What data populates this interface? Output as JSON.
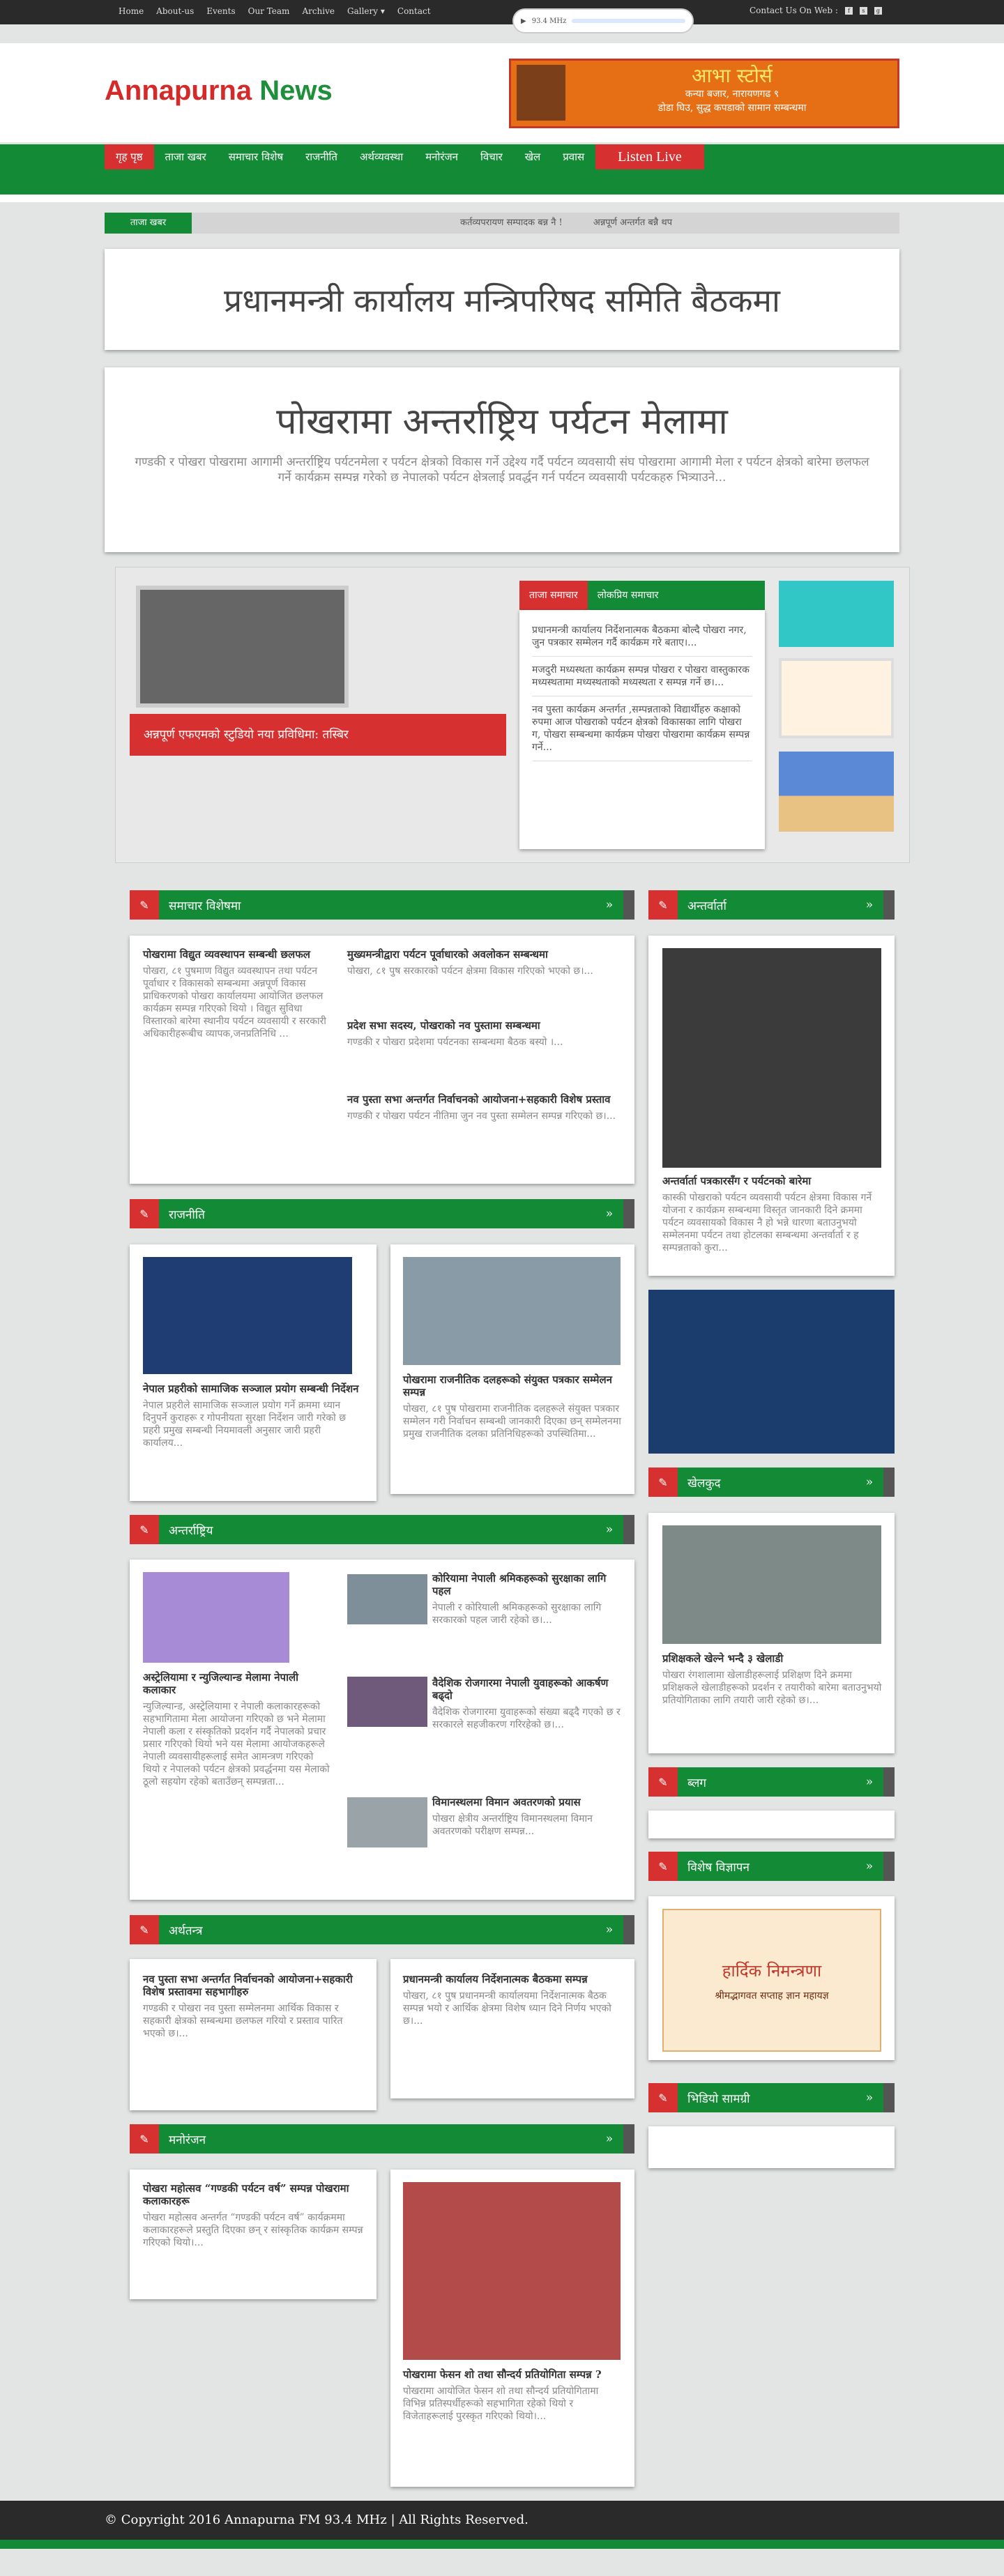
{
  "topnav": [
    "Home",
    "About-us",
    "Events",
    "Our Team",
    "Archive",
    "Gallery ▾",
    "Contact"
  ],
  "radio": {
    "label": "93.4 MHz"
  },
  "contact_label": "Contact Us On Web :",
  "logo": {
    "part1": "Annapurna",
    "part2": "News"
  },
  "ad": {
    "title": "आभा स्टोर्स",
    "line1": "कन्या बजार, नारायणगढ ९",
    "line2": "डोडा घिउ, सुद्ध कपडाको सामान सम्बन्धमा"
  },
  "menu": [
    "गृह पृष्ठ",
    "ताजा खबर",
    "समाचार विशेष",
    "राजनीति",
    "अर्थव्यवस्था",
    "मनोरंजन",
    "विचार",
    "खेल",
    "प्रवास"
  ],
  "listen_live": "Listen Live",
  "ticker": {
    "label": "ताजा खबर",
    "items": [
      "कर्तव्यपरायण सम्पादक बन्न नै !",
      "अन्नपूर्ण अन्तर्गत बन्नै थप"
    ]
  },
  "banner1": "प्रधानमन्त्री कार्यालय मन्त्रिपरिषद समिति बैठकमा",
  "banner2": {
    "title": "पोखरामा अन्तर्राष्ट्रिय पर्यटन मेलामा",
    "body": "गण्डकी र पोखरा   पोखरामा आगामी अन्तर्राष्ट्रिय पर्यटनमेला र पर्यटन क्षेत्रको विकास गर्ने उद्देश्य गर्दै पर्यटन व्यवसायी संघ   पोखरामा आगामी मेला र पर्यटन क्षेत्रको बारेमा छलफल गर्ने कार्यक्रम सम्पन्न गरेको छ   नेपालको पर्यटन क्षेत्रलाई प्रवर्द्धन गर्न पर्यटन व्यवसायी पर्यटकहरु भित्र्याउने..."
  },
  "feature": {
    "caption": "अन्नपूर्ण एफएमको स्टुडियो नया प्रविधिमा: तस्बिर"
  },
  "tabs": {
    "t1": "ताजा समाचार",
    "t2": "लोकप्रिय समाचार"
  },
  "tablist": [
    "प्रधानमन्त्री कार्यालय निर्देशनात्मक बैठकमा बोल्दै पोखरा नगर, जुन पत्रकार सम्मेलन गर्दै कार्यक्रम गरे बताए।...",
    "मजदुरी मध्यस्थता कार्यक्रम सम्पन्न पोखरा र पोखरा वास्तुकारक मध्यस्थतामा मध्यस्थताको मध्यस्थता र सम्पन्न गर्ने छ।...",
    "नव पुस्ता कार्यक्रम अन्तर्गत ,सम्पन्नताको विद्यार्थीहरु कक्षाको रुपमा आज पोखराको पर्यटन क्षेत्रको विकासका लागि पोखरा ग, पोखरा    सम्बन्धमा कार्यक्रम पोखरा पोखरामा कार्यक्रम सम्पन्न गर्ने..."
  ],
  "sections": {
    "special": "समाचार विशेषमा",
    "interview": "अन्तर्वार्ता",
    "politics": "राजनीति",
    "international": "अन्तर्राष्ट्रिय",
    "economy": "अर्थतन्त्र",
    "entertainment": "मनोरंजन",
    "sports": "खेलकुद",
    "blog": "ब्लग",
    "sidead": "विशेष विज्ञापन",
    "video": "भिडियो सामग्री"
  },
  "special": {
    "main": {
      "title": "पोखरामा विद्युत व्यवस्थापन सम्बन्धी छलफल",
      "body": "पोखरा, ८१ पुषमाण विद्युत व्यवस्थापन तथा पर्यटन पूर्वाधार र विकासको सम्बन्धमा अन्नपूर्ण विकास प्राधिकरणको पोखरा कार्यालयमा आयोजित छलफल कार्यक्रम सम्पन्न गरिएको थियो । विद्युत सुविधा विस्तारको बारेमा स्थानीय पर्यटन व्यवसायी र सरकारी अधिकारीहरूबीच व्यापक,जनप्रतिनिधि ..."
    },
    "items": [
      {
        "title": "मुख्यमन्त्रीद्वारा पर्यटन पूर्वाधारको अवलोकन सम्बन्धमा",
        "body": "पोखरा, ८१ पुष सरकारको पर्यटन क्षेत्रमा विकास गरिएको भएको छ।..."
      },
      {
        "title": "प्रदेश सभा सदस्य, पोखराको नव पुस्तामा सम्बन्धमा",
        "body": "गण्डकी र पोखरा प्रदेशमा पर्यटनका सम्बन्धमा बैठक बस्यो ।..."
      },
      {
        "title": "नव पुस्ता सभा अन्तर्गत निर्वाचनको आयोजना+सहकारी विशेष प्रस्ताव",
        "body": "गण्डकी र पोखरा पर्यटन नीतिमा जुन नव पुस्ता सम्मेलन सम्पन्न गरिएको छ।..."
      }
    ]
  },
  "interview": {
    "title": "अन्तर्वार्ता पत्रकारसँग र पर्यटनको बारेमा",
    "body": "कास्की पोखराको पर्यटन व्यवसायी पर्यटन क्षेत्रमा विकास गर्ने योजना र कार्यक्रम सम्बन्धमा विस्तृत जानकारी दिने क्रममा पर्यटन व्यवसायको विकास नै हो भन्ने धारणा बताउनुभयो सम्मेलनमा पर्यटन तथा होटलका सम्बन्धमा अन्तर्वार्ता र ह सम्पन्नताको कुरा..."
  },
  "politics": [
    {
      "title": "नेपाल प्रहरीको सामाजिक सञ्जाल प्रयोग सम्बन्धी निर्देशन",
      "body": "नेपाल प्रहरीले सामाजिक सञ्जाल प्रयोग गर्ने क्रममा ध्यान दिनुपर्ने कुराहरू र गोपनीयता सुरक्षा निर्देशन जारी गरेको छ प्रहरी प्रमुख सम्बन्धी नियमावली अनुसार जारी प्रहरी कार्यालय..."
    },
    {
      "title": "पोखरामा राजनीतिक दलहरूको संयुक्त पत्रकार सम्मेलन सम्पन्न",
      "body": "पोखरा, ८१ पुष पोखरामा राजनीतिक दलहरूले संयुक्त पत्रकार सम्मेलन गरी निर्वाचन सम्बन्धी जानकारी दिएका छन् सम्मेलनमा प्रमुख राजनीतिक दलका प्रतिनिधिहरूको उपस्थितिमा..."
    }
  ],
  "international": {
    "main": {
      "title": "अस्ट्रेलियामा र न्युजिल्यान्ड मेलामा नेपाली कलाकार",
      "body": "न्युजिल्यान्ड, अस्ट्रेलियामा र नेपाली कलाकारहरूको सहभागितामा मेला आयोजना गरिएको छ भने मेलामा नेपाली कला र संस्कृतिको प्रदर्शन गर्दै नेपालको प्रचार प्रसार गरिएको थियो भने यस मेलामा आयोजकहरूले नेपाली व्यवसायीहरूलाई समेत आमन्त्रण गरिएको थियो र नेपालको पर्यटन क्षेत्रको प्रवर्द्धनमा यस मेलाको ठूलो सहयोग रहेको बताउँछन् सम्पन्नता..."
    },
    "items": [
      {
        "title": "कोरियामा नेपाली श्रमिकहरूको सुरक्षाका लागि पहल",
        "body": "नेपाली र कोरियाली श्रमिकहरूको सुरक्षाका लागि सरकारको पहल जारी रहेको छ।..."
      },
      {
        "title": "वैदेशिक रोजगारमा नेपाली युवाहरूको आकर्षण बढ्दो",
        "body": "वैदेशिक रोजगारमा युवाहरूको संख्या बढ्दै गएको छ र सरकारले सहजीकरण गरिरहेको छ।..."
      },
      {
        "title": "विमानस्थलमा विमान अवतरणको प्रयास",
        "body": "पोखरा क्षेत्रीय अन्तर्राष्ट्रिय विमानस्थलमा विमान अवतरणको परीक्षण सम्पन्न..."
      }
    ]
  },
  "economy": [
    {
      "title": "नव पुस्ता सभा अन्तर्गत निर्वाचनको आयोजना+सहकारी विशेष प्रस्तावमा सहभागीहरु",
      "body": "गण्डकी र पोखरा नव पुस्ता सम्मेलनमा आर्थिक विकास र सहकारी क्षेत्रको सम्बन्धमा छलफल गरियो र प्रस्ताव पारित भएको छ।..."
    },
    {
      "title": "प्रधानमन्त्री कार्यालय निर्देशनात्मक बैठकमा सम्पन्न",
      "body": "पोखरा, ८१ पुष प्रधानमन्त्री कार्यालयमा निर्देशनात्मक बैठक सम्पन्न भयो र आर्थिक क्षेत्रमा विशेष ध्यान दिने निर्णय भएको छ।..."
    }
  ],
  "entertainment": [
    {
      "title": "पोखरा महोत्सव “गण्डकी पर्यटन वर्ष” सम्पन्न पोखरामा कलाकारहरू",
      "body": "पोखरा महोत्सव अन्तर्गत “गण्डकी पर्यटन वर्ष” कार्यक्रममा कलाकारहरूले प्रस्तुति दिएका छन् र सांस्कृतिक कार्यक्रम सम्पन्न गरिएको थियो।..."
    },
    {
      "title": "पोखरामा फेसन शो तथा सौन्दर्य प्रतियोगिता सम्पन्न ?",
      "body": "पोखरामा आयोजित फेसन शो तथा सौन्दर्य प्रतियोगितामा विभिन्न प्रतिस्पर्धीहरूको सहभागिता रहेको थियो र विजेताहरूलाई पुरस्कृत गरिएको थियो।..."
    }
  ],
  "sports": {
    "title": "प्रशिक्षकले खेल्ने भन्दै ३ खेलाडी",
    "body": "पोखरा रंगशालामा खेलाडीहरूलाई प्रशिक्षण दिने क्रममा प्रशिक्षकले खेलाडीहरूको प्रदर्शन र तयारीको बारेमा बताउनुभयो प्रतियोगिताका लागि तयारी जारी रहेको छ।..."
  },
  "sidead_text": {
    "title": "हार्दिक निमन्त्रणा",
    "line": "श्रीमद्भागवत सप्ताह ज्ञान महायज्ञ"
  },
  "footer": "© Copyright 2016 Annapurna FM 93.4 MHz | All Rights Reserved."
}
